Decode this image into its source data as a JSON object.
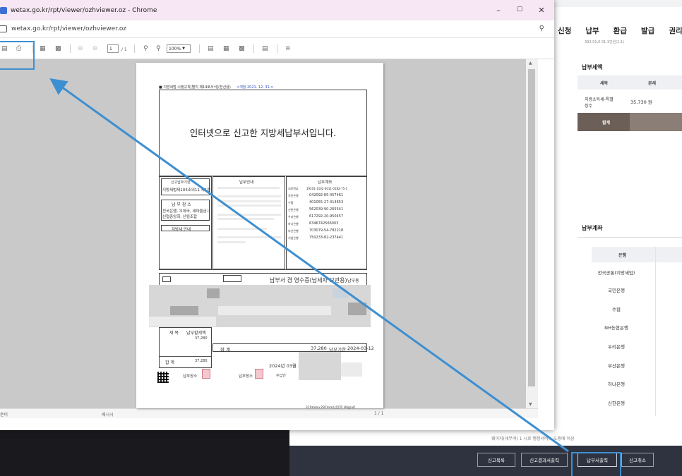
{
  "window": {
    "title": "wetax.go.kr/rpt/viewer/ozhviewer.oz - Chrome",
    "url": "wetax.go.kr/rpt/viewer/ozhviewer.oz",
    "minimize": "–",
    "maximize": "☐",
    "close": "✕"
  },
  "toolbar": {
    "page_current": "1",
    "page_total": "/ 1",
    "zoom": "100%"
  },
  "statusbar": {
    "left": "준비",
    "mid": "페시시",
    "page": "1 / 1"
  },
  "document": {
    "header_note": "■ 지방세법 시행규칙[별지 제14호서식](전산용)",
    "header_revision": "<개정 2021. 12. 31.>",
    "main_title": "인터넷으로 신고한 지방세납부서입니다.",
    "box_left_1_title": "신고납부기한",
    "box_left_1_value": "지방세법제103조의11 제1항",
    "box_left_2_title": "납 부 장 소",
    "box_left_2_lines": [
      "전국은행, 우체국, 새마을금고",
      "신협중앙회, 산림조합"
    ],
    "box_left_3_title": "지방세 안내",
    "box_mid_title": "납부안내",
    "box_right_title": "납부계좌",
    "accounts": [
      {
        "bank": "지로번호",
        "no": "19201-1102-0011-0182-75-1"
      },
      {
        "bank": "국민은행",
        "no": "042092-85-457461"
      },
      {
        "bank": "수협",
        "no": "401055-27-414653"
      },
      {
        "bank": "신한은행",
        "no": "562039-90-265541"
      },
      {
        "bank": "우리은행",
        "no": "617292-20-950457"
      },
      {
        "bank": "하나은행",
        "no": "6346742566003"
      },
      {
        "bank": "부산은행",
        "no": "703079-54-782218"
      },
      {
        "bank": "기업은행",
        "no": "750233-82-237441"
      }
    ],
    "receipt_title": "납부서 겸 영수증(납세자 보관용)",
    "receipt_tag": "납부용",
    "amount_tax": "37,280",
    "total_label": "합 계",
    "total_value": "37,280",
    "due_label": "납부기한 :",
    "due_date": "2024-03-12",
    "date_line": "2024년 03월 1",
    "stamp_label": "납부장소",
    "stamp_label2": "수납인",
    "left_total_label": "합  계",
    "left_total_value": "37,280",
    "left_tax_label": "세 목",
    "left_tax_value": "납부할세액",
    "footer_size": "210mm×297mm(신문지 80g/㎡)"
  },
  "bgpage": {
    "nav": [
      "신청",
      "납부",
      "환급",
      "발급",
      "권리보호"
    ],
    "top_hint": "393,91,0 01.1만원(1.1)",
    "tax_section_title": "납부세액",
    "tax_table_headers": [
      "세목",
      "본세"
    ],
    "tax_row_name": "지방소득세-특별징수",
    "tax_row_value": "35,730 원",
    "tax_total_label": "합계",
    "account_section_title": "납부계좌",
    "account_header": "은행",
    "banks": [
      "전국공통(지방세입)",
      "국민은행",
      "수협",
      "NH농협은행",
      "우리은행",
      "부산은행",
      "하나은행",
      "신한은행"
    ],
    "note": "웨이지(세무여) 1 시로 행정서비스 도중에 이상",
    "buttons": [
      "신고목록",
      "신고결과서출력",
      "납부서출력",
      "신고취소"
    ]
  },
  "colors": {
    "highlight": "#3d8fd1",
    "titlebar": "#f7e6f3",
    "actionbar": "#2f3340"
  }
}
